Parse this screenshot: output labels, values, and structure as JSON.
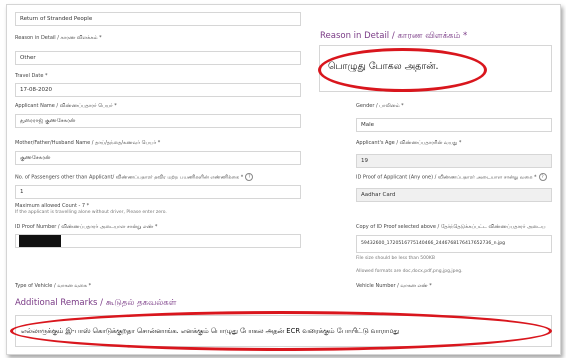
{
  "purpose_value": "Return of Stranded People",
  "reason": {
    "label": "Reason in Detail / காரண விளக்கம் *",
    "value": "Other"
  },
  "reason_detail": {
    "label": "Reason in Detail / காரண விளக்கம் *",
    "value": "பொழுது போகல அதான்."
  },
  "travel_date": {
    "label": "Travel Date *",
    "value": "17-08-2020"
  },
  "applicant_name": {
    "label": "Applicant Name / விண்ணப்பதாரர் பெயர் *",
    "value": "துரைராஜ் குணசேகரன்"
  },
  "gender": {
    "label": "Gender / பாலினம் *",
    "value": "Male"
  },
  "parent_name": {
    "label": "Mother/Father/Husband Name / தாய்/தந்தை/கணவர் பெயர் *",
    "value": "குணசேகரன்"
  },
  "age": {
    "label": "Applicant's Age / விண்ணப்பதாரரின் வயது *",
    "value": "19"
  },
  "passengers": {
    "label": "No. of Passengers other than Applicant/ விண்ணப்பதாரர் தவிர மற்ற பயணிகளின் எண்ணிக்கை *",
    "help": "?",
    "value": "1",
    "max": "Maximum allowed Count - 7 *",
    "hint": "If the applicant is travelling alone without driver, Please enter zero."
  },
  "id_proof": {
    "label": "ID Proof Number / விண்ணப்பதாரர் அடையாள சான்று எண் *"
  },
  "id_proof_type": {
    "label": "ID Proof of Applicant (Any one) / விண்ணப்பதாரர் அடையாள சான்று வகை *",
    "value": "Aadhar Card",
    "help": "?"
  },
  "id_copy": {
    "label": "Copy of ID Proof selected above / தேர்ந்தெடுக்கப்பட்ட விண்ணப்பதாரர் அடைய",
    "value": "59432600_1720516775140466_2446768176417652736_n.jpg",
    "size_hint": "File size should be less than 500KB",
    "formats": "Allowed formats are doc,docx,pdf,png,jpg,jpeg."
  },
  "vehicle_type": {
    "label": "Type of Vehicle / வாகன வகை *"
  },
  "vehicle_number": {
    "label": "Vehicle Number / வாகன எண் *"
  },
  "remarks": {
    "label": "Additional Remarks / கூடுதல் தகவல்கள்",
    "value": "எல்லாருக்கும் இ-பாஸ் கொடுக்குறதா சொன்னாங்க. எனக்கும் பொழுது போகல அதன் ECR வரைக்கும் போயிட்டு வாராமது"
  },
  "colors": {
    "annotation_red": "#d9161d",
    "section_purple": "#7a3b86"
  }
}
